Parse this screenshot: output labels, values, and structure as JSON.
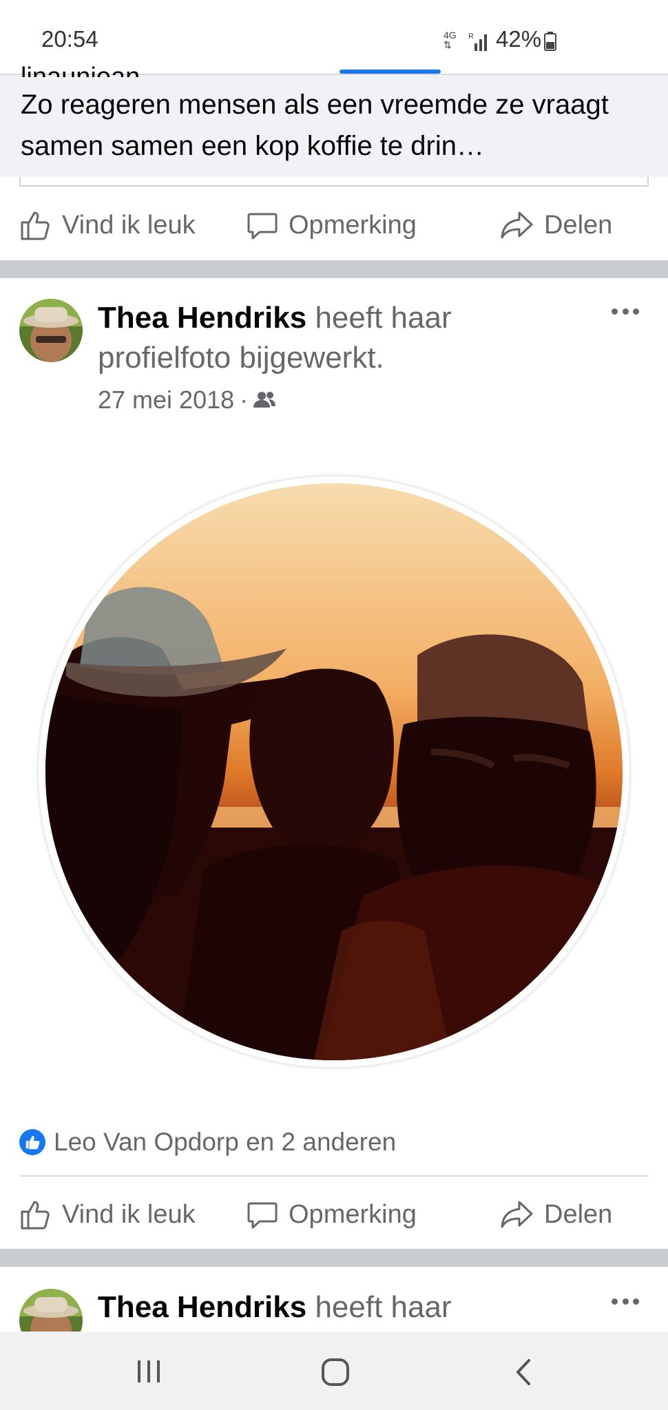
{
  "status_bar": {
    "time": "20:54",
    "network": "4G",
    "roaming": "R",
    "battery": "42%"
  },
  "shared_post": {
    "title": "Zo reageren mensen als een vreemde ze vraagt samen samen een kop koffie te drin…",
    "truncated_line": "linauniean..."
  },
  "actions": {
    "like": "Vind ik leuk",
    "comment": "Opmerking",
    "share": "Delen"
  },
  "post": {
    "author": "Thea Hendriks",
    "action_text": "heeft haar profielfoto bijgewerkt.",
    "date": "27 mei 2018",
    "separator": "·",
    "audience_icon": "friends-icon",
    "reactions_text": "Leo Van Opdorp en 2 anderen"
  },
  "next_post": {
    "author": "Thea Hendriks",
    "action_text": "heeft haar"
  },
  "colors": {
    "accent": "#1877f2",
    "muted": "#65676b",
    "separator": "#c9ccd1"
  }
}
